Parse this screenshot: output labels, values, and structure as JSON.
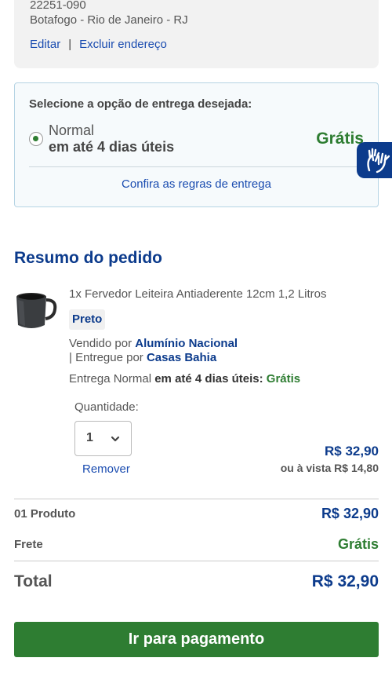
{
  "address": {
    "zip": "22251-090",
    "city": "Botafogo - Rio de Janeiro - RJ",
    "edit_label": "Editar",
    "separator": "|",
    "delete_label": "Excluir endereço"
  },
  "delivery": {
    "title": "Selecione a opção de entrega desejada:",
    "option_name": "Normal",
    "option_time": "em até 4 dias úteis",
    "option_price": "Grátis",
    "selected": true,
    "rules_link": "Confira as regras de entrega"
  },
  "accessibility": {
    "icon": "sign-language-hands-icon"
  },
  "summary": {
    "title": "Resumo do pedido",
    "product": {
      "name": "1x Fervedor Leiteira Antiaderente 12cm 1,2 Litros",
      "color": "Preto",
      "sold_by_prefix": "Vendido por",
      "seller": "Alumínio Nacional",
      "delivered_by_prefix": "| Entregue por",
      "deliverer": "Casas Bahia",
      "delivery_prefix": "Entrega Normal",
      "delivery_time": "em até 4 dias úteis:",
      "delivery_price": "Grátis",
      "quantity_label": "Quantidade:",
      "quantity": "1",
      "remove_label": "Remover",
      "price": "R$ 32,90",
      "cash_price": "ou à vista R$ 14,80"
    }
  },
  "totals": {
    "products_label": "01 Produto",
    "products_value": "R$ 32,90",
    "freight_label": "Frete",
    "freight_value": "Grátis",
    "total_label": "Total",
    "total_value": "R$ 32,90"
  },
  "pay_button": "Ir para pagamento",
  "colors": {
    "brand_blue": "#0c3b8c",
    "link_blue": "#1a4cb0",
    "green": "#2e7d32"
  }
}
